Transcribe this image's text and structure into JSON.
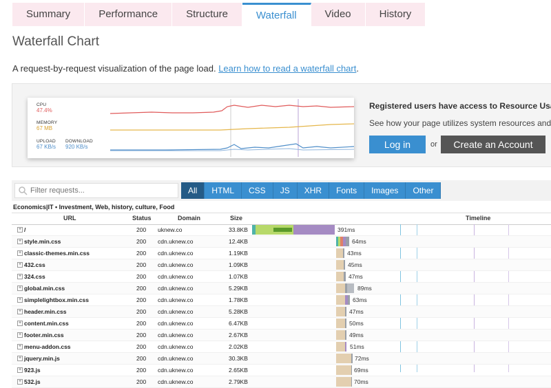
{
  "tabs": [
    {
      "label": "Summary",
      "active": false
    },
    {
      "label": "Performance",
      "active": false
    },
    {
      "label": "Structure",
      "active": false
    },
    {
      "label": "Waterfall",
      "active": true
    },
    {
      "label": "Video",
      "active": false
    },
    {
      "label": "History",
      "active": false
    }
  ],
  "page_title": "Waterfall Chart",
  "intro": {
    "text": "A request-by-request visualization of the page load. ",
    "link": "Learn how to read a waterfall chart",
    "end": "."
  },
  "promo": {
    "metrics": {
      "cpu_label": "CPU",
      "cpu_value": "47.4%",
      "memory_label": "MEMORY",
      "memory_value": "67 MB",
      "upload_label": "UPLOAD",
      "upload_value": "67 KB/s",
      "download_label": "DOWNLOAD",
      "download_value": "920 KB/s"
    },
    "title": "Registered users have access to Resource Usage",
    "subtitle": "See how your page utilizes system resources and add",
    "login_label": "Log in",
    "or_label": "or",
    "create_label": "Create an Account",
    "colors": {
      "cpu": "#e05a5a",
      "memory": "#e5b64a",
      "network": "#4f8ec9"
    }
  },
  "filter": {
    "placeholder": "Filter requests...",
    "buttons": [
      {
        "label": "All",
        "active": true
      },
      {
        "label": "HTML",
        "active": false
      },
      {
        "label": "CSS",
        "active": false
      },
      {
        "label": "JS",
        "active": false
      },
      {
        "label": "XHR",
        "active": false
      },
      {
        "label": "Fonts",
        "active": false
      },
      {
        "label": "Images",
        "active": false
      },
      {
        "label": "Other",
        "active": false
      }
    ]
  },
  "page_label": "Economics|IT • Investment, Web, history, culture, Food",
  "table": {
    "headers": {
      "url": "URL",
      "status": "Status",
      "domain": "Domain",
      "size": "Size",
      "timeline": "Timeline"
    },
    "rows": [
      {
        "url": "/",
        "status": "200",
        "domain": "uknew.co",
        "size": "33.8KB",
        "time": "391ms"
      },
      {
        "url": "style.min.css",
        "status": "200",
        "domain": "cdn.uknew.co",
        "size": "12.4KB",
        "time": "64ms"
      },
      {
        "url": "classic-themes.min.css",
        "status": "200",
        "domain": "cdn.uknew.co",
        "size": "1.19KB",
        "time": "43ms"
      },
      {
        "url": "432.css",
        "status": "200",
        "domain": "cdn.uknew.co",
        "size": "1.09KB",
        "time": "45ms"
      },
      {
        "url": "324.css",
        "status": "200",
        "domain": "cdn.uknew.co",
        "size": "1.07KB",
        "time": "47ms"
      },
      {
        "url": "global.min.css",
        "status": "200",
        "domain": "cdn.uknew.co",
        "size": "5.29KB",
        "time": "89ms"
      },
      {
        "url": "simplelightbox.min.css",
        "status": "200",
        "domain": "cdn.uknew.co",
        "size": "1.78KB",
        "time": "63ms"
      },
      {
        "url": "header.min.css",
        "status": "200",
        "domain": "cdn.uknew.co",
        "size": "5.28KB",
        "time": "47ms"
      },
      {
        "url": "content.min.css",
        "status": "200",
        "domain": "cdn.uknew.co",
        "size": "6.47KB",
        "time": "50ms"
      },
      {
        "url": "footer.min.css",
        "status": "200",
        "domain": "cdn.uknew.co",
        "size": "2.67KB",
        "time": "49ms"
      },
      {
        "url": "menu-addon.css",
        "status": "200",
        "domain": "cdn.uknew.co",
        "size": "2.02KB",
        "time": "51ms"
      },
      {
        "url": "jquery.min.js",
        "status": "200",
        "domain": "cdn.uknew.co",
        "size": "30.3KB",
        "time": "72ms"
      },
      {
        "url": "923.js",
        "status": "200",
        "domain": "cdn.uknew.co",
        "size": "2.65KB",
        "time": "69ms"
      },
      {
        "url": "532.js",
        "status": "200",
        "domain": "cdn.uknew.co",
        "size": "2.79KB",
        "time": "70ms"
      }
    ]
  },
  "bar_colors": {
    "dns": "#4fb3a8",
    "connect": "#b7d96a",
    "wait": "#a58bc3",
    "receive": "#e3cfb0",
    "blocked": "#9aa0a8",
    "first_byte": "#5a9a2a"
  }
}
